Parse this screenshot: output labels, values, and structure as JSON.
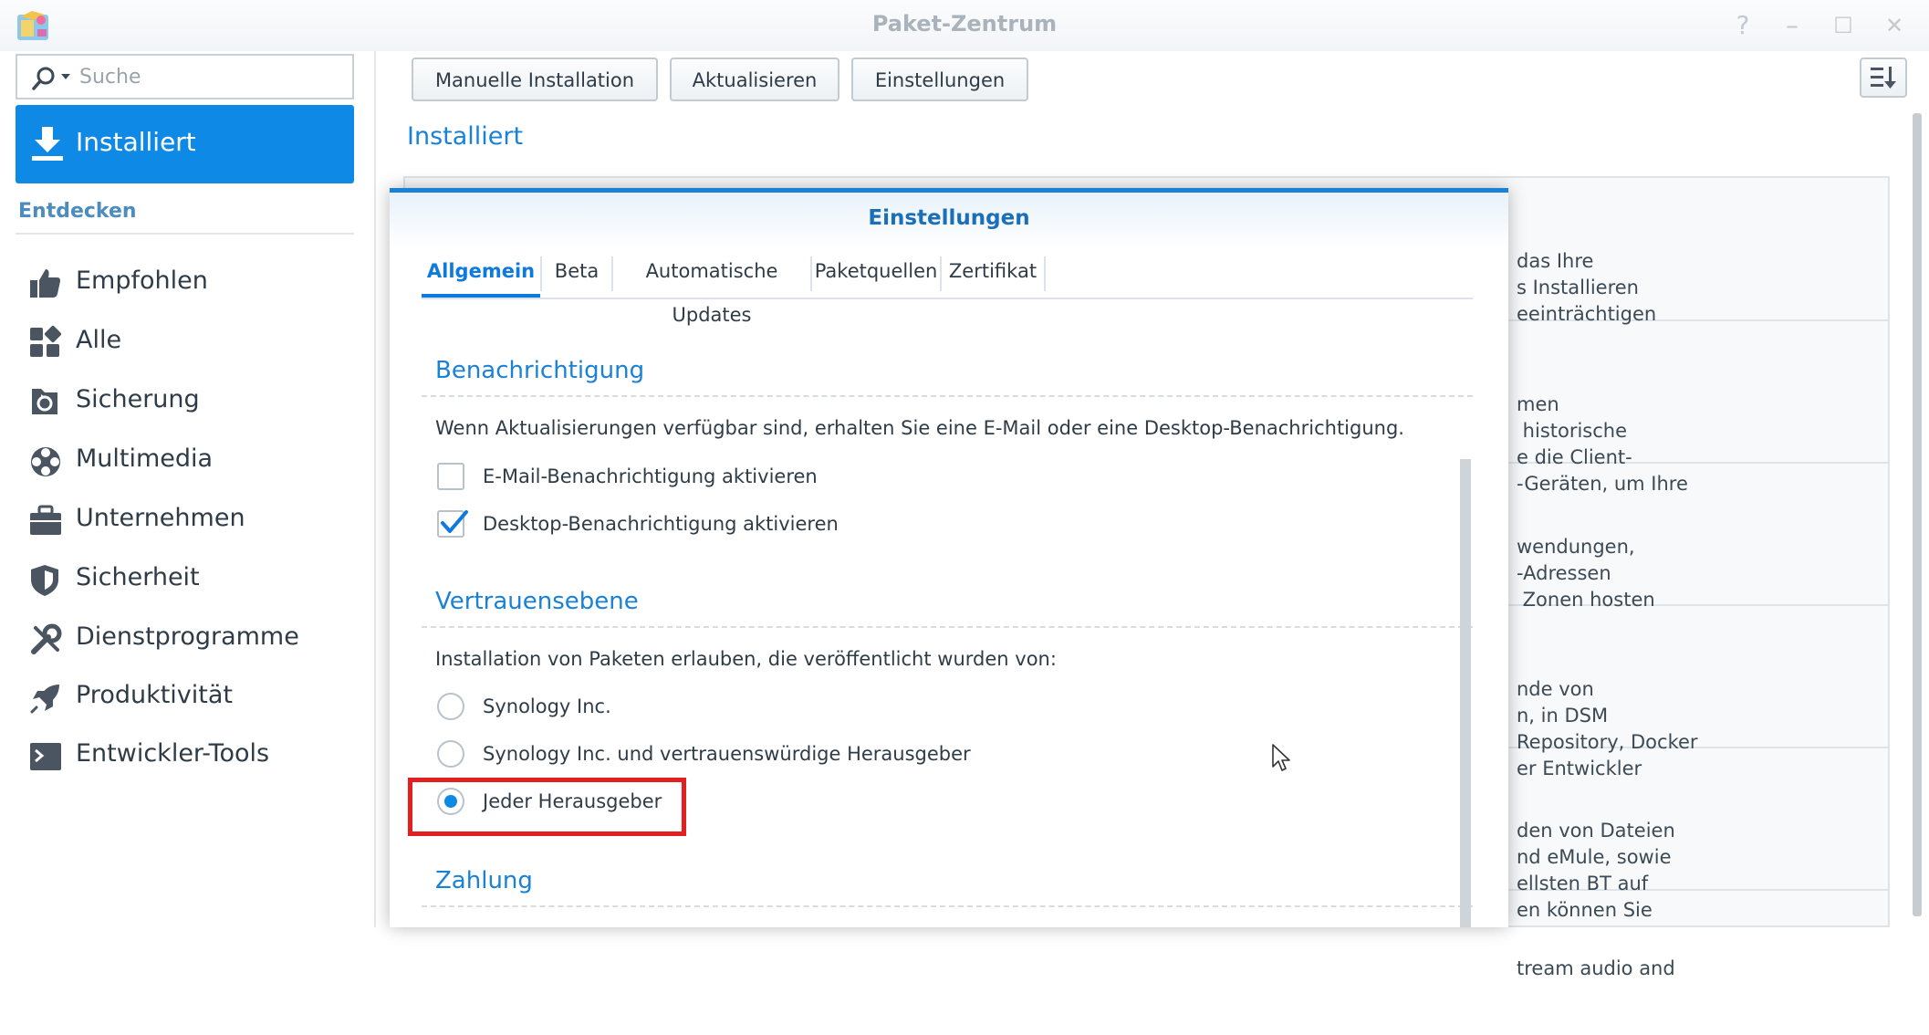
{
  "window": {
    "title": "Paket-Zentrum",
    "controls": [
      "?",
      "–",
      "☐",
      "✕"
    ]
  },
  "sidebar": {
    "search_placeholder": "Suche",
    "active_item": "Installiert",
    "section_heading": "Entdecken",
    "items": [
      "Empfohlen",
      "Alle",
      "Sicherung",
      "Multimedia",
      "Unternehmen",
      "Sicherheit",
      "Dienstprogramme",
      "Produktivität",
      "Entwickler-Tools"
    ]
  },
  "toolbar": {
    "manual_install": "Manuelle Installation",
    "update": "Aktualisieren",
    "settings": "Einstellungen"
  },
  "main": {
    "heading": "Installiert",
    "packages": [
      [
        "das Ihre",
        "s Installieren",
        "eeinträchtigen"
      ],
      [
        "men",
        " historische",
        "e die Client-",
        "-Geräten, um Ihre"
      ],
      [
        "wendungen,",
        "-Adressen",
        " Zonen hosten"
      ],
      [
        "nde von",
        "n, in DSM",
        "Repository, Docker",
        "er Entwickler"
      ],
      [
        "den von Dateien",
        "nd eMule, sowie",
        "ellsten BT auf",
        "en können Sie"
      ],
      [
        "tream audio and"
      ]
    ]
  },
  "dialog": {
    "title": "Einstellungen",
    "tabs": [
      "Allgemein",
      "Beta",
      "Automatische Updates",
      "Paketquellen",
      "Zertifikat"
    ],
    "notification": {
      "title": "Benachrichtigung",
      "description": "Wenn Aktualisierungen verfügbar sind, erhalten Sie eine E-Mail oder eine Desktop-Benachrichtigung.",
      "email_label": "E-Mail-Benachrichtigung aktivieren",
      "email_checked": false,
      "desktop_label": "Desktop-Benachrichtigung aktivieren",
      "desktop_checked": true
    },
    "trust": {
      "title": "Vertrauensebene",
      "description": "Installation von Paketen erlauben, die veröffentlicht wurden von:",
      "options": [
        "Synology Inc.",
        "Synology Inc. und vertrauenswürdige Herausgeber",
        "Jeder Herausgeber"
      ],
      "selected": "Jeder Herausgeber"
    },
    "payment": {
      "title": "Zahlung"
    }
  },
  "colors": {
    "accent": "#0e8ae6",
    "heading_blue": "#1a82d6",
    "highlight_red": "#e41f1f"
  }
}
